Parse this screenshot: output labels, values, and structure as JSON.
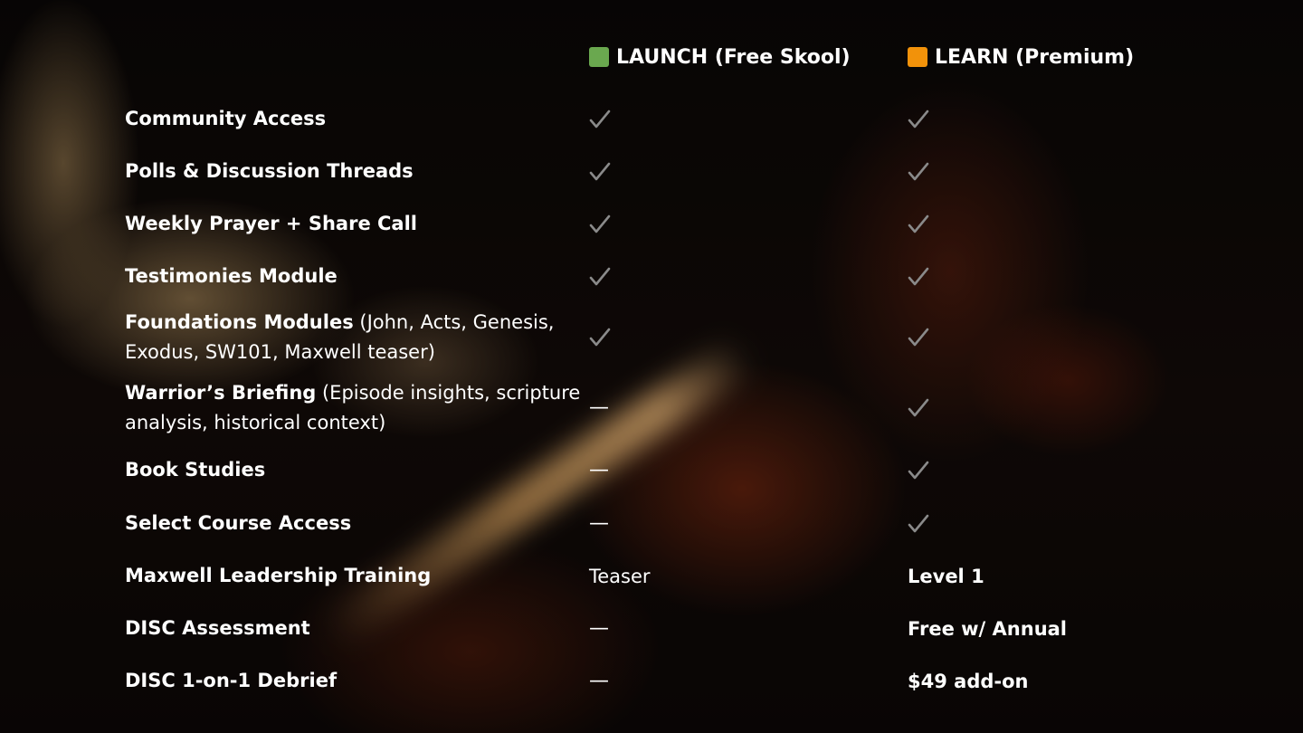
{
  "columns": {
    "launch": {
      "label": "LAUNCH (Free Skool)",
      "color": "#6aa84f"
    },
    "learn": {
      "label": "LEARN (Premium)",
      "color": "#f2920a"
    }
  },
  "rows": [
    {
      "feature": "Community Access",
      "detail": "",
      "launch": "check",
      "learn": "check"
    },
    {
      "feature": "Polls & Discussion Threads",
      "detail": "",
      "launch": "check",
      "learn": "check"
    },
    {
      "feature": "Weekly Prayer + Share Call",
      "detail": "",
      "launch": "check",
      "learn": "check"
    },
    {
      "feature": "Testimonies Module",
      "detail": "",
      "launch": "check",
      "learn": "check"
    },
    {
      "feature": "Foundations Modules",
      "detail": " (John, Acts, Genesis, Exodus, SW101, Maxwell teaser)",
      "launch": "check",
      "learn": "check"
    },
    {
      "feature": "Warrior’s Briefing",
      "detail": " (Episode insights, scripture analysis, historical context)",
      "launch": "—",
      "learn": "check"
    },
    {
      "feature": "Book Studies",
      "detail": "",
      "launch": "—",
      "learn": "check"
    },
    {
      "feature": "Select Course Access",
      "detail": "",
      "launch": "—",
      "learn": "check"
    },
    {
      "feature": "Maxwell Leadership Training",
      "detail": "",
      "launch": "Teaser",
      "learn": "Level 1"
    },
    {
      "feature": "DISC Assessment",
      "detail": "",
      "launch": "—",
      "learn": "Free w/ Annual"
    },
    {
      "feature": "DISC 1-on-1 Debrief",
      "detail": "",
      "launch": "—",
      "learn": "$49 add-on"
    }
  ],
  "icons": {
    "check": "check-icon"
  },
  "check_color": "#8a8a8a"
}
